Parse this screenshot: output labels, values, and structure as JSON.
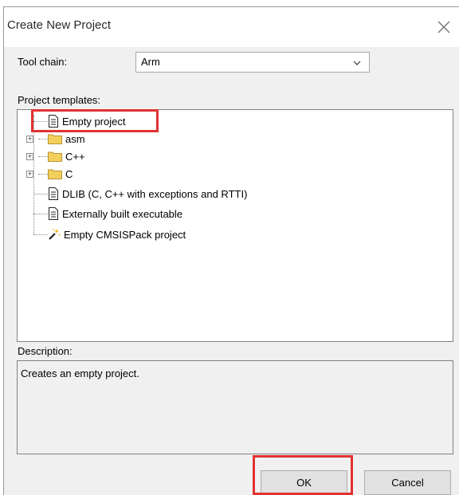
{
  "dialog": {
    "title": "Create New Project",
    "toolchain_label": "Tool chain:",
    "toolchain_value": "Arm",
    "templates_label": "Project templates:",
    "templates": [
      {
        "label": "Empty project",
        "icon": "document-icon",
        "expandable": false,
        "selected": true
      },
      {
        "label": "asm",
        "icon": "folder-icon",
        "expandable": true
      },
      {
        "label": "C++",
        "icon": "folder-icon",
        "expandable": true
      },
      {
        "label": "C",
        "icon": "folder-icon",
        "expandable": true
      },
      {
        "label": "DLIB (C, C++ with exceptions and RTTI)",
        "icon": "document-icon",
        "expandable": false
      },
      {
        "label": "Externally built executable",
        "icon": "document-icon",
        "expandable": false
      },
      {
        "label": "Empty CMSISPack project",
        "icon": "magic-wand-icon",
        "expandable": false
      }
    ],
    "description_label": "Description:",
    "description_text": "Creates an empty project.",
    "ok_label": "OK",
    "cancel_label": "Cancel"
  },
  "colors": {
    "highlight": "#e23232",
    "folder": "#f3cf5c",
    "dialog_bg": "#f0f0f0"
  }
}
